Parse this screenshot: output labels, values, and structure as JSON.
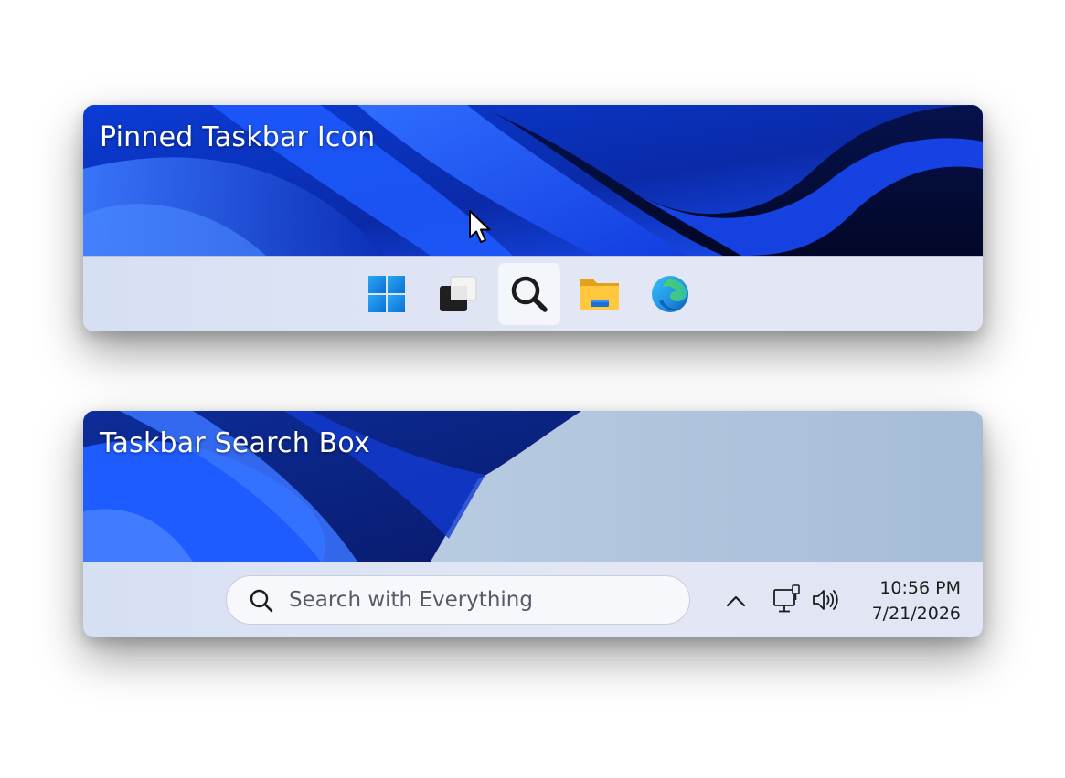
{
  "panels": [
    {
      "title": "Pinned Taskbar Icon",
      "taskbar_icons": [
        {
          "name": "windows-start-icon",
          "hovered": false
        },
        {
          "name": "task-view-icon",
          "hovered": false
        },
        {
          "name": "search-icon",
          "hovered": true
        },
        {
          "name": "file-explorer-icon",
          "hovered": false
        },
        {
          "name": "edge-browser-icon",
          "hovered": false
        }
      ],
      "cursor": "arrow-pointer-icon"
    },
    {
      "title": "Taskbar Search Box",
      "search": {
        "placeholder": "Search with Everything",
        "value": ""
      },
      "tray": {
        "icons": [
          "chevron-up-icon",
          "network-icon",
          "volume-icon"
        ],
        "time": "10:56 PM",
        "date": "7/21/2026"
      }
    }
  ],
  "colors": {
    "wallpaper_blue": "#1a5cff",
    "wallpaper_dark": "#030a3a",
    "taskbar_bg": "#dfe6f4",
    "light_wallpaper": "#b0c4dc"
  }
}
